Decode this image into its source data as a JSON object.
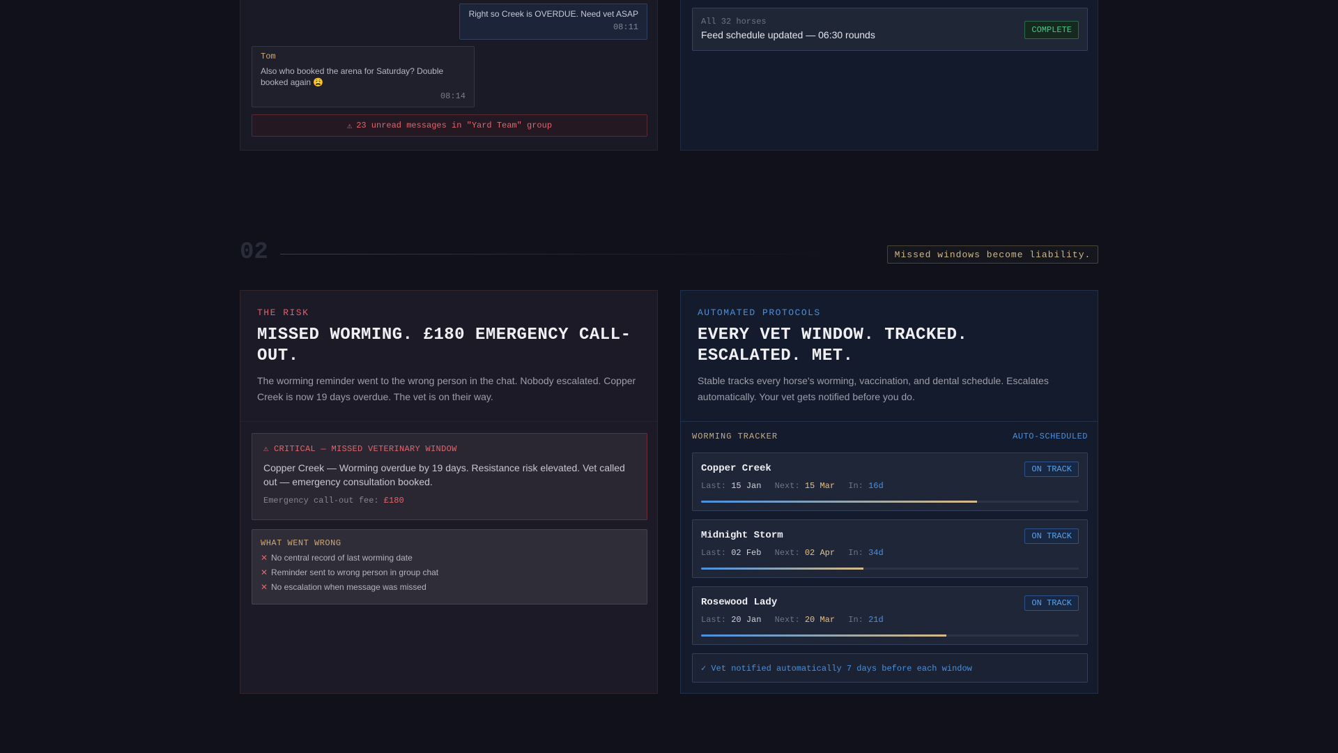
{
  "chat": {
    "self_message": {
      "text": "Right so Creek is OVERDUE. Need vet ASAP",
      "time": "08:11"
    },
    "other_message": {
      "sender": "Tom",
      "text": "Also who booked the arena for Saturday? Double booked again 😩",
      "time": "08:14"
    },
    "unread_icon": "⚠",
    "unread_text": "23 unread messages in \"Yard Team\" group"
  },
  "feed": {
    "sub": "All 32 horses",
    "main": "Feed schedule updated — 06:30 rounds",
    "badge": "COMPLETE"
  },
  "section": {
    "number": "02",
    "tagline": "Missed windows become liability."
  },
  "risk": {
    "eyebrow": "THE RISK",
    "headline": "MISSED WORMING. £180 EMERGENCY CALL-OUT.",
    "description": "The worming reminder went to the wrong person in the chat. Nobody escalated. Copper Creek is now 19 days overdue. The vet is on their way.",
    "critical_title": "⚠ CRITICAL — MISSED VETERINARY WINDOW",
    "critical_body": "Copper Creek — Worming overdue by 19 days. Resistance risk elevated. Vet called out — emergency consultation booked.",
    "fee_label": "Emergency call-out fee:",
    "fee_amount": "£180",
    "wrong_title": "WHAT WENT WRONG",
    "wrong_items": [
      "No central record of last worming date",
      "Reminder sent to wrong person in group chat",
      "No escalation when message was missed"
    ]
  },
  "protocols": {
    "eyebrow": "AUTOMATED PROTOCOLS",
    "headline": "EVERY VET WINDOW. TRACKED. ESCALATED. MET.",
    "description": "Stable tracks every horse's worming, vaccination, and dental schedule. Escalates automatically. Your vet gets notified before you do.",
    "tracker_label": "WORMING TRACKER",
    "tracker_mode": "AUTO-SCHEDULED",
    "last_label": "Last:",
    "next_label": "Next:",
    "in_label": "In:",
    "horses": [
      {
        "name": "Copper Creek",
        "status": "ON TRACK",
        "last": "15 Jan",
        "next": "15 Mar",
        "in": "16d",
        "progress": 0.73
      },
      {
        "name": "Midnight Storm",
        "status": "ON TRACK",
        "last": "02 Feb",
        "next": "02 Apr",
        "in": "34d",
        "progress": 0.43
      },
      {
        "name": "Rosewood Lady",
        "status": "ON TRACK",
        "last": "20 Jan",
        "next": "20 Mar",
        "in": "21d",
        "progress": 0.65
      }
    ],
    "notify_text": "✓ Vet notified automatically 7 days before each window"
  },
  "colors": {
    "background": "#10111b",
    "alert_red": "#e0666c",
    "accent_blue": "#4b8fdc",
    "accent_gold": "#d2a86e",
    "success_green": "#47c98a"
  }
}
